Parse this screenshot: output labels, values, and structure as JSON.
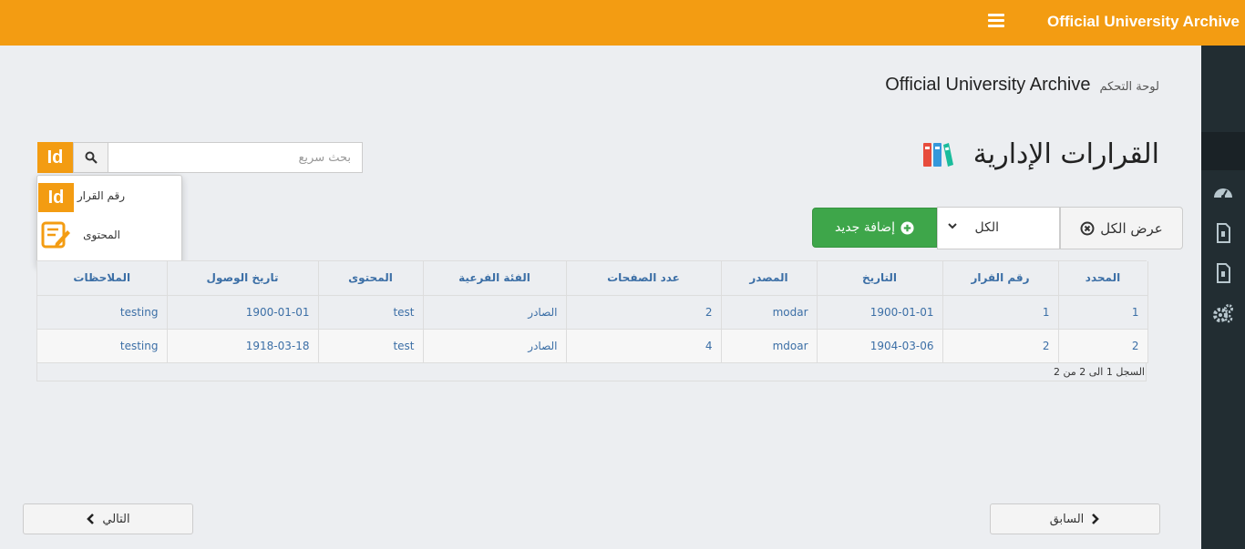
{
  "header": {
    "brand": "Official University Archive",
    "menu_icon": "hamburger-icon",
    "color": "#f39c12"
  },
  "sidebar": {
    "items": [
      {
        "icon": "dashboard-icon"
      },
      {
        "icon": "document-icon"
      },
      {
        "icon": "document-icon"
      },
      {
        "icon": "settings-icon"
      }
    ]
  },
  "breadcrumb": {
    "title": "Official University Archive",
    "home": "لوحة التحكم"
  },
  "page": {
    "title": "القرارات الإدارية",
    "icon": "binders-icon"
  },
  "search": {
    "mode_label": "Id",
    "placeholder": "بحث سريع",
    "value": "",
    "dropdown": [
      {
        "label": "رقم القرار",
        "icon": "id-icon"
      },
      {
        "label": "المحتوى",
        "icon": "edit-icon"
      }
    ]
  },
  "toolbar": {
    "show_all": "عرض الكل",
    "filter_value": "الكل",
    "add_new": "إضافة جديد",
    "add_color": "#3ea64a"
  },
  "table": {
    "columns": [
      "المحدد",
      "رقم القرار",
      "التاريخ",
      "المصدر",
      "عدد الصفحات",
      "الفئة الفرعية",
      "المحتوى",
      "تاريخ الوصول",
      "الملاحظات"
    ],
    "rows": [
      [
        "1",
        "1",
        "1900-01-01",
        "modar",
        "2",
        "الصادر",
        "test",
        "1900-01-01",
        "testing"
      ],
      [
        "2",
        "2",
        "1904-03-06",
        "mdoar",
        "4",
        "الصادر",
        "test",
        "1918-03-18",
        "testing"
      ]
    ],
    "record_info": "السجل 1 الى 2 من 2"
  },
  "pagination": {
    "previous": "السابق",
    "next": "التالي"
  }
}
